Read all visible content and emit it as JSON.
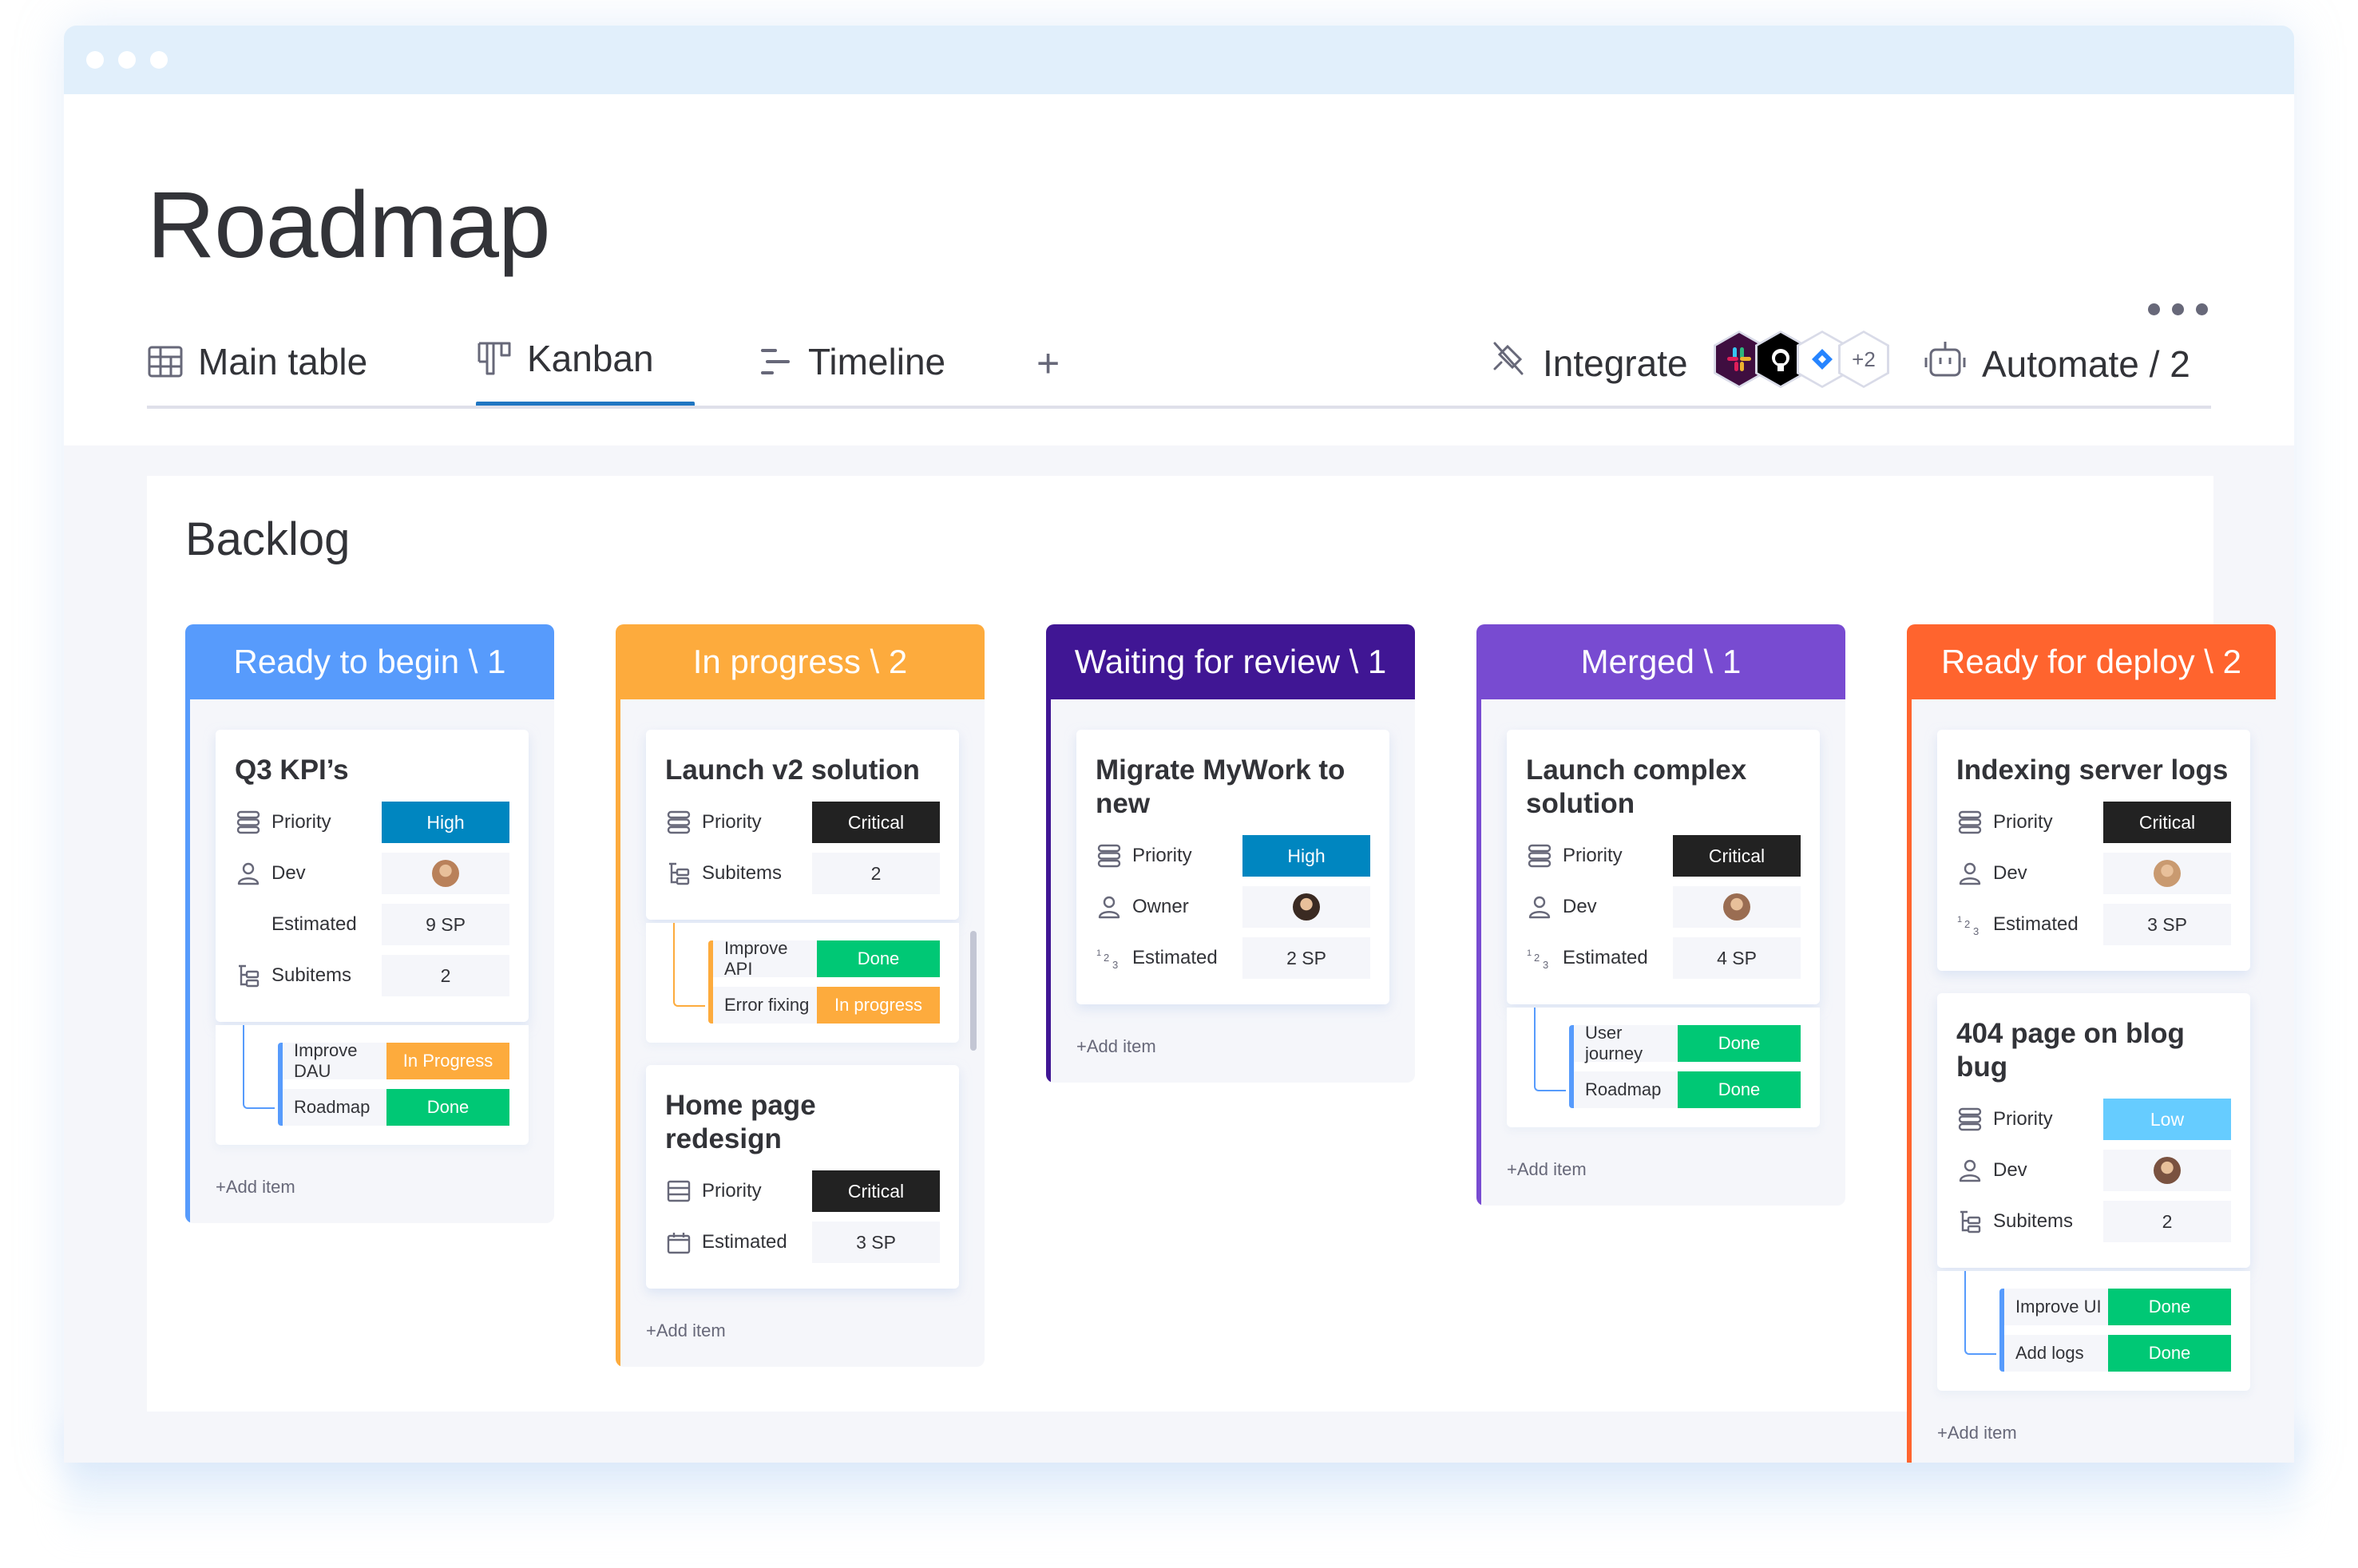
{
  "window": {
    "title_dots": 3
  },
  "header": {
    "title": "Roadmap",
    "more_icon": "ellipsis-icon",
    "tabs": [
      {
        "label": "Main table",
        "icon": "table-icon",
        "active": false
      },
      {
        "label": "Kanban",
        "icon": "kanban-icon",
        "active": true
      },
      {
        "label": "Timeline",
        "icon": "timeline-icon",
        "active": false
      }
    ],
    "add_view_label": "+",
    "integrate": {
      "label": "Integrate",
      "icon": "integrate-plug-icon",
      "apps": [
        "slack",
        "github",
        "jira"
      ],
      "more_count": "+2"
    },
    "automate": {
      "label": "Automate / 2",
      "icon": "robot-icon"
    }
  },
  "colors": {
    "accent": "#1f76c2",
    "high": "#0086c0",
    "critical": "#222222",
    "low": "#66ccff",
    "done": "#00c875",
    "in_progress": "#fdab3d"
  },
  "board": {
    "group_title": "Backlog",
    "add_item_label": "+Add item",
    "columns": [
      {
        "title": "Ready to begin \\ 1",
        "color": "#579bfc",
        "cards": [
          {
            "title": "Q3 KPI’s",
            "fields": [
              {
                "icon": "priority-icon",
                "label": "Priority",
                "value": "High",
                "type": "status",
                "color": "#0086c0"
              },
              {
                "icon": "person-icon",
                "label": "Dev",
                "type": "avatar",
                "avatar_color": "#b9815a"
              },
              {
                "icon": "none",
                "label": "Estimated",
                "value": "9 SP",
                "type": "text"
              },
              {
                "icon": "subitems-icon",
                "label": "Subitems",
                "value": "2",
                "type": "text"
              }
            ],
            "subitems": [
              {
                "name": "Improve DAU",
                "status": "In Progress",
                "color": "#fdab3d"
              },
              {
                "name": "Roadmap",
                "status": "Done",
                "color": "#00c875"
              }
            ]
          }
        ]
      },
      {
        "title": "In progress \\ 2",
        "color": "#fdab3d",
        "cards": [
          {
            "title": "Launch v2 solution",
            "fields": [
              {
                "icon": "priority-icon",
                "label": "Priority",
                "value": "Critical",
                "type": "status",
                "color": "#222222"
              },
              {
                "icon": "subitems-icon",
                "label": "Subitems",
                "value": "2",
                "type": "text"
              }
            ],
            "subitems": [
              {
                "name": "Improve API",
                "status": "Done",
                "color": "#00c875"
              },
              {
                "name": "Error fixing",
                "status": "In progress",
                "color": "#fdab3d"
              }
            ]
          },
          {
            "title": "Home page redesign",
            "fields": [
              {
                "icon": "list-box-icon",
                "label": "Priority",
                "value": "Critical",
                "type": "status",
                "color": "#222222"
              },
              {
                "icon": "calendar-icon",
                "label": "Estimated",
                "value": "3 SP",
                "type": "text"
              }
            ]
          }
        ]
      },
      {
        "title": "Waiting for review \\ 1",
        "color": "#401694",
        "cards": [
          {
            "title": "Migrate MyWork to new",
            "fields": [
              {
                "icon": "priority-icon",
                "label": "Priority",
                "value": "High",
                "type": "status",
                "color": "#0086c0"
              },
              {
                "icon": "person-icon",
                "label": "Owner",
                "type": "avatar",
                "avatar_color": "#3a2a22"
              },
              {
                "icon": "numbers-icon",
                "label": "Estimated",
                "value": "2 SP",
                "type": "text"
              }
            ]
          }
        ]
      },
      {
        "title": "Merged \\ 1",
        "color": "#784bd1",
        "cards": [
          {
            "title": "Launch complex solution",
            "fields": [
              {
                "icon": "priority-icon",
                "label": "Priority",
                "value": "Critical",
                "type": "status",
                "color": "#222222"
              },
              {
                "icon": "person-icon",
                "label": "Dev",
                "type": "avatar",
                "avatar_color": "#9a6d52"
              },
              {
                "icon": "numbers-icon",
                "label": "Estimated",
                "value": "4 SP",
                "type": "text"
              }
            ],
            "subitems": [
              {
                "name": "User journey",
                "status": "Done",
                "color": "#00c875"
              },
              {
                "name": "Roadmap",
                "status": "Done",
                "color": "#00c875"
              }
            ]
          }
        ]
      },
      {
        "title": "Ready for deploy \\ 2",
        "color": "#ff642e",
        "cards": [
          {
            "title": "Indexing server logs",
            "fields": [
              {
                "icon": "priority-icon",
                "label": "Priority",
                "value": "Critical",
                "type": "status",
                "color": "#222222"
              },
              {
                "icon": "person-icon",
                "label": "Dev",
                "type": "avatar",
                "avatar_color": "#c99a70"
              },
              {
                "icon": "numbers-icon",
                "label": "Estimated",
                "value": "3 SP",
                "type": "text"
              }
            ]
          },
          {
            "title": "404 page on blog bug",
            "fields": [
              {
                "icon": "priority-icon",
                "label": "Priority",
                "value": "Low",
                "type": "status",
                "color": "#66ccff"
              },
              {
                "icon": "person-icon",
                "label": "Dev",
                "type": "avatar",
                "avatar_color": "#7a5240"
              },
              {
                "icon": "subitems-icon",
                "label": "Subitems",
                "value": "2",
                "type": "text"
              }
            ],
            "subitems": [
              {
                "name": "Improve UI",
                "status": "Done",
                "color": "#00c875"
              },
              {
                "name": "Add logs",
                "status": "Done",
                "color": "#00c875"
              }
            ]
          }
        ]
      }
    ]
  }
}
